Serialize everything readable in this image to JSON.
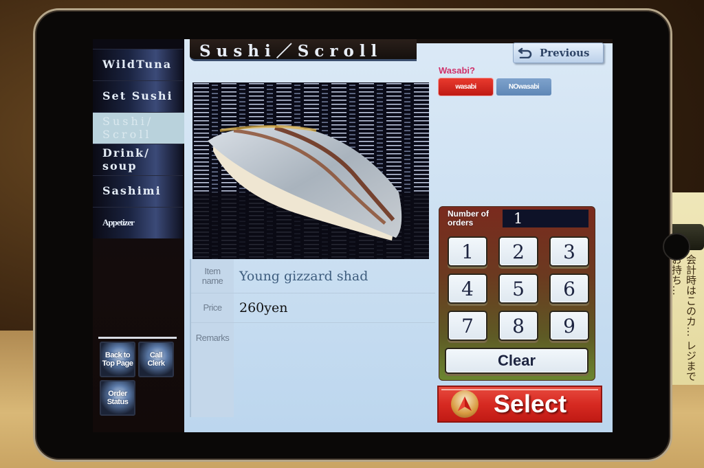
{
  "sidebar": {
    "items": [
      {
        "label": "WildTuna",
        "active": false
      },
      {
        "label": "Set Sushi",
        "active": false
      },
      {
        "label": "Sushi/ Scroll",
        "active": true
      },
      {
        "label": "Drink/ soup",
        "active": false
      },
      {
        "label": "Sashimi",
        "active": false
      },
      {
        "label": "Appetizer",
        "active": false
      }
    ],
    "utility_buttons": {
      "back_to_top": "Back to Top Page",
      "call_clerk": "Call Clerk",
      "order_status": "Order Status"
    }
  },
  "header": {
    "title": "Sushi／Scroll",
    "previous_label": "Previous"
  },
  "wasabi": {
    "question": "Wasabi?",
    "options": [
      "wasabi",
      "NOwasabi"
    ],
    "selected": "wasabi"
  },
  "item": {
    "photo_icon": "sushi-photo",
    "name_label": "Item name",
    "name_value": "Young gizzard shad",
    "price_label": "Price",
    "price_value": "260yen",
    "remarks_label": "Remarks",
    "remarks_value": ""
  },
  "order": {
    "count_label": "Number of orders",
    "count_value": "1",
    "keys": [
      "1",
      "2",
      "3",
      "4",
      "5",
      "6",
      "7",
      "8",
      "9"
    ],
    "clear_label": "Clear",
    "select_label": "Select"
  },
  "colors": {
    "accent_red": "#d72a22",
    "wasabi_pink": "#d0316a",
    "panel_blue": "#c9def1"
  },
  "environment": {
    "card_text": "会計時はこのカ… レジまでお持ち…"
  }
}
